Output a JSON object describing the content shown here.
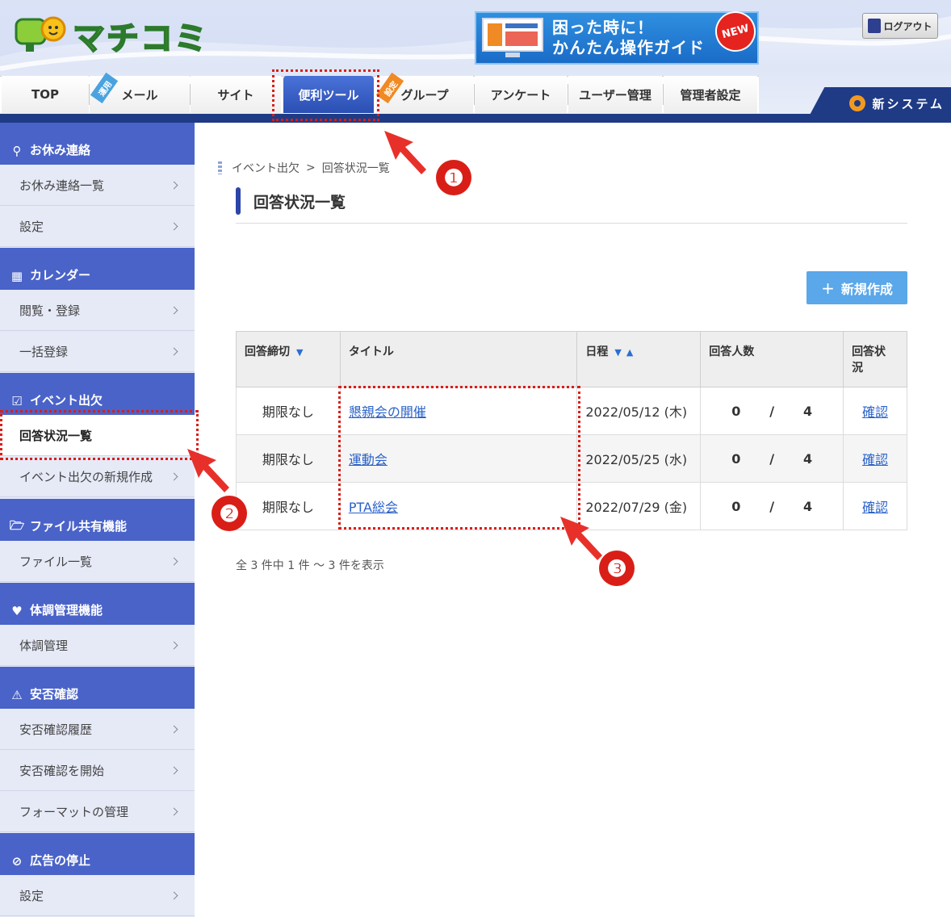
{
  "header": {
    "logo_text": "マチコミ",
    "banner_line1": "困った時に！",
    "banner_line2": "かんたん操作ガイド",
    "banner_badge": "NEW",
    "logout_label": "ログアウト"
  },
  "tabs": [
    {
      "label": "TOP"
    },
    {
      "label": "メール",
      "ribbon": "運用"
    },
    {
      "label": "サイト"
    },
    {
      "label": "便利ツール"
    },
    {
      "label": "グループ",
      "ribbon": "設定"
    },
    {
      "label": "アンケート"
    },
    {
      "label": "ユーザー管理"
    },
    {
      "label": "管理者設定"
    }
  ],
  "new_system_label": "新システム",
  "sidebar": {
    "sections": [
      {
        "title": "お休み連絡",
        "items": [
          "お休み連絡一覧",
          "設定"
        ]
      },
      {
        "title": "カレンダー",
        "items": [
          "閲覧・登録",
          "一括登録"
        ]
      },
      {
        "title": "イベント出欠",
        "items": [
          "回答状況一覧",
          "イベント出欠の新規作成"
        ]
      },
      {
        "title": "ファイル共有機能",
        "items": [
          "ファイル一覧"
        ]
      },
      {
        "title": "体調管理機能",
        "items": [
          "体調管理"
        ]
      },
      {
        "title": "安否確認",
        "items": [
          "安否確認履歴",
          "安否確認を開始",
          "フォーマットの管理"
        ]
      },
      {
        "title": "広告の停止",
        "items": [
          "設定"
        ]
      }
    ]
  },
  "breadcrumb": {
    "parent": "イベント出欠",
    "sep": ">",
    "current": "回答状況一覧"
  },
  "page_title": "回答状況一覧",
  "new_button_label": "新規作成",
  "table": {
    "headers": {
      "deadline": "回答締切",
      "title": "タイトル",
      "date": "日程",
      "count": "回答人数",
      "status_line1": "回答状",
      "status_line2": "況"
    },
    "rows": [
      {
        "deadline": "期限なし",
        "title": "懇親会の開催",
        "date": "2022/05/12 (木)",
        "answered": "0",
        "slash": "/",
        "total": "4",
        "status": "確認"
      },
      {
        "deadline": "期限なし",
        "title": "運動会",
        "date": "2022/05/25 (水)",
        "answered": "0",
        "slash": "/",
        "total": "4",
        "status": "確認"
      },
      {
        "deadline": "期限なし",
        "title": "PTA総会",
        "date": "2022/07/29 (金)",
        "answered": "0",
        "slash": "/",
        "total": "4",
        "status": "確認"
      }
    ]
  },
  "pager_text": "全 3 件中 1 件 ～ 3 件を表示",
  "annotations": [
    "❶",
    "❷",
    "❸"
  ],
  "colors": {
    "nav_blue": "#1f3b86",
    "sidebar_head": "#4a63c9",
    "accent_red": "#d91e18",
    "button_blue": "#5aa7ea",
    "link_blue": "#2a62c9"
  }
}
